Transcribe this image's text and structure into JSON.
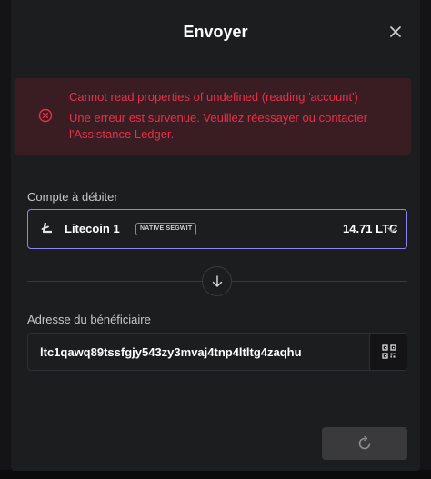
{
  "modal": {
    "title": "Envoyer",
    "close_icon": "close-icon"
  },
  "error": {
    "icon": "error-circle-x-icon",
    "title": "Cannot read properties of undefined (reading 'account')",
    "description": "Une erreur est survenue. Veuillez réessayer ou contacter l'Assistance Ledger.",
    "color": "#ea2e49"
  },
  "account": {
    "label": "Compte à débiter",
    "name": "Litecoin 1",
    "tag": "NATIVE SEGWIT",
    "balance": "14.71 LTC",
    "currency_icon": "litecoin-icon",
    "chevron_icon": "chevron-down-icon",
    "accent_color": "#8d87f2"
  },
  "swap": {
    "icon": "arrow-down-icon"
  },
  "recipient": {
    "label": "Adresse du bénéficiaire",
    "value": "ltc1qawq89tssfgjy543zy3mvaj4tnp4ltltg4zaqhu",
    "qr_icon": "qr-code-icon"
  },
  "footer": {
    "continue_icon": "loading-spinner-icon"
  }
}
